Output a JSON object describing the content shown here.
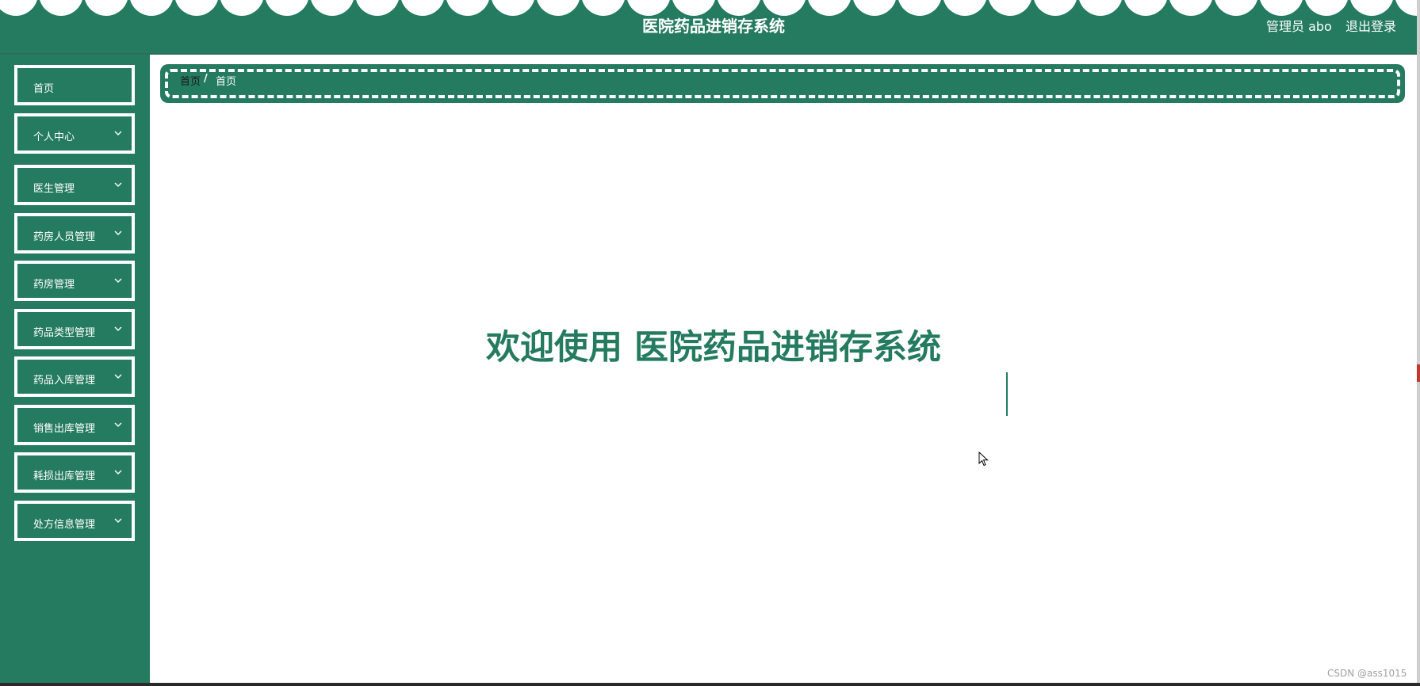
{
  "header": {
    "title": "医院药品进销存系统",
    "user": "管理员 abo",
    "logout": "退出登录"
  },
  "sidebar": {
    "items": [
      {
        "label": "首页",
        "expandable": false
      },
      {
        "label": "个人中心",
        "expandable": true
      },
      {
        "label": "医生管理",
        "expandable": true
      },
      {
        "label": "药房人员管理",
        "expandable": true
      },
      {
        "label": "药房管理",
        "expandable": true
      },
      {
        "label": "药品类型管理",
        "expandable": true
      },
      {
        "label": "药品入库管理",
        "expandable": true
      },
      {
        "label": "销售出库管理",
        "expandable": true
      },
      {
        "label": "耗损出库管理",
        "expandable": true
      },
      {
        "label": "处方信息管理",
        "expandable": true
      }
    ]
  },
  "breadcrumb": {
    "home": "首页",
    "separator": "/",
    "current": "首页"
  },
  "main": {
    "welcome": "欢迎使用 医院药品进销存系统"
  },
  "watermark": "CSDN @ass1015",
  "colors": {
    "primary": "#257b5f",
    "background": "#ffffff",
    "menu_border": "#ffffff",
    "watermark": "#a0a0a0"
  },
  "icons": {
    "expand": "chevron-down-icon",
    "pointer": "mouse-cursor-icon"
  }
}
